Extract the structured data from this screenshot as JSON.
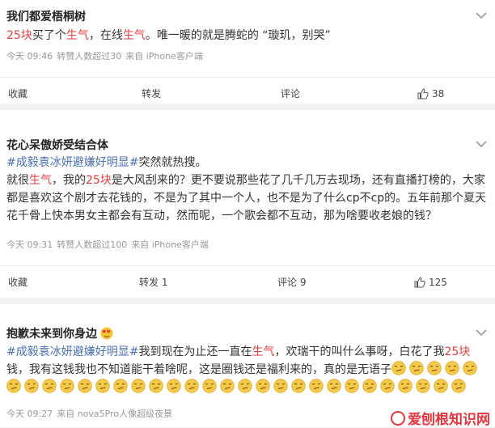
{
  "posts": [
    {
      "user": "我们都爱梧桐树",
      "line1": {
        "a": "25块",
        "b": "买了个",
        "c": "生气",
        "d": "，在线",
        "e": "生气",
        "f": "。唯一暖的就是腾蛇的 “璇玑，别哭”"
      },
      "meta": {
        "time": "今天 09:46",
        "reposts": "转赞人数超过30",
        "source": "来自 iPhone客户端"
      },
      "actions": {
        "collect": "收藏",
        "repost": "转发",
        "comment": "评论",
        "like_count": "38"
      }
    },
    {
      "user": "花心呆傲娇受结合体",
      "lines": [
        {
          "a": "#成毅袁冰妍避嫌好明显#",
          "b": "突然就热搜。"
        },
        {
          "a": "就很",
          "b": "生气",
          "c": "，我的",
          "d": "25块",
          "e": "是大风刮来的？更不要说那些花了几千几万去现场，还有直播打榜的，大家"
        },
        {
          "a": "都是喜欢这个剧才去花钱的，不是为了其中一个人，也不是为了什么cp不cp的。五年前那个夏天"
        },
        {
          "a": "花千骨上快本男女主都会有互动，然而呢，一个歌会都不互动，那为啥要收老娘的钱？"
        }
      ],
      "meta": {
        "time": "今天 09:31",
        "reposts": "转赞人数超过100",
        "source": "来自 iPhone客户端"
      },
      "actions": {
        "collect": "收藏",
        "repost": "转发 1",
        "comment": "评论 9",
        "like_count": "125"
      }
    },
    {
      "user": "抱歉未来到你身边",
      "lines": [
        {
          "a": "#成毅袁冰妍避嫌好明显#",
          "b": "我到现在为止还一直在",
          "c": "生气",
          "d": "，欢瑞干的叫什么事呀，白花了我",
          "e": "25块"
        },
        {
          "a": "钱，我有这钱我也不知道能干着啥呢，这是圈钱还是福利来的，真的是无语子"
        }
      ],
      "meta": {
        "time": "今天 09:27",
        "source": "来自 nova5Pro人像超级夜景"
      }
    }
  ],
  "watermark": "爱刨根知识网",
  "colors": {
    "highlight_red": "#e63e3e",
    "topic_blue": "#4a73b8",
    "meta_gray": "#999999"
  },
  "icons": {
    "menu": "chevron-down-icon",
    "like": "thumbs-up-icon",
    "heart": "heart-eyes-emoji",
    "emoji": "smirk-emoji"
  }
}
